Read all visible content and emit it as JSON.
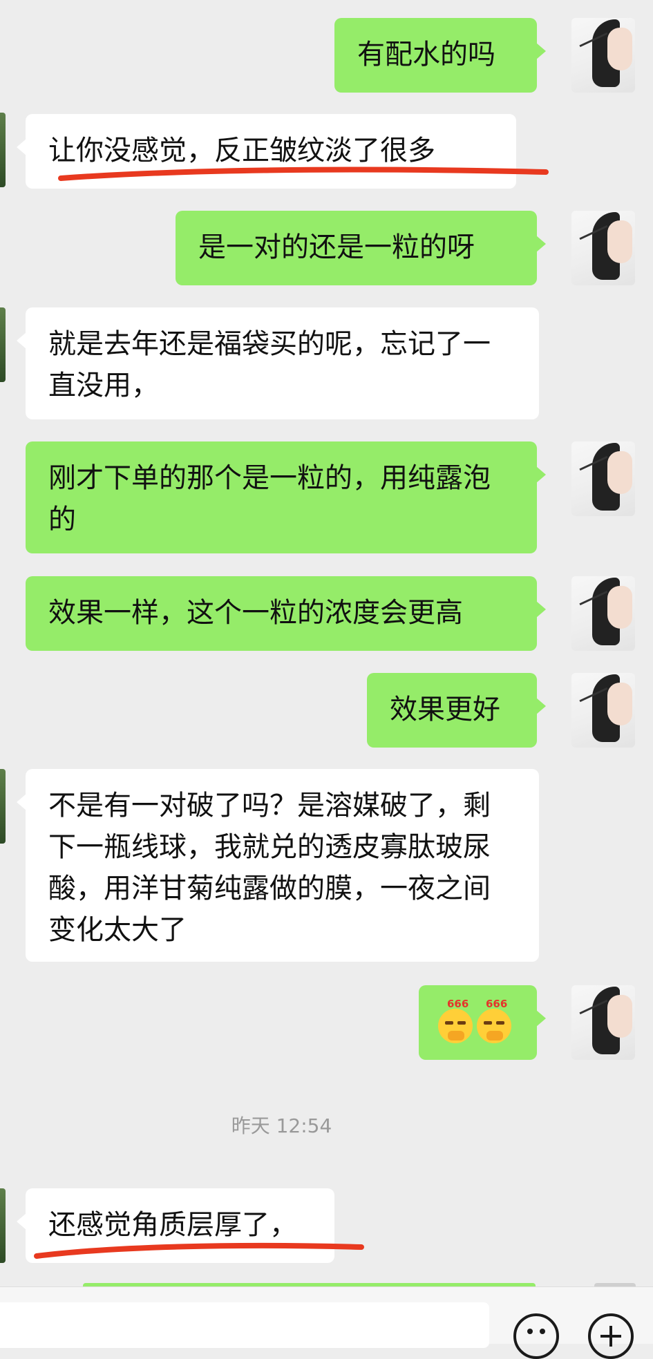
{
  "chat": {
    "messages": [
      {
        "sender": "me",
        "text": "有配水的吗"
      },
      {
        "sender": "them",
        "text": "让你没感觉，反正皱纹淡了很多"
      },
      {
        "sender": "me",
        "text": "是一对的还是一粒的呀"
      },
      {
        "sender": "them",
        "text": "就是去年还是福袋买的呢，忘记了一直没用，"
      },
      {
        "sender": "me",
        "text": "刚才下单的那个是一粒的，用纯露泡的"
      },
      {
        "sender": "me",
        "text": "效果一样，这个一粒的浓度会更高"
      },
      {
        "sender": "me",
        "text": "效果更好"
      },
      {
        "sender": "them",
        "text": "不是有一对破了吗？是溶媒破了，剩下一瓶线球，我就兑的透皮寡肽玻尿酸，用洋甘菊纯露做的膜，一夜之间变化太大了"
      },
      {
        "sender": "me",
        "type": "emoji",
        "emojis": [
          {
            "name": "666-emoji",
            "label": "666"
          },
          {
            "name": "666-emoji",
            "label": "666"
          }
        ]
      },
      {
        "sender": "them",
        "text": "还感觉角质层厚了，"
      }
    ],
    "timestamp": "昨天 12:54"
  },
  "annotations": {
    "underline_color": "#e8391f"
  },
  "colors": {
    "background": "#ededed",
    "my_bubble": "#95ec69",
    "their_bubble": "#ffffff",
    "timestamp_text": "#999999"
  },
  "input_bar": {
    "emoji_icon": "emoji-smiley-icon",
    "plus_icon": "plus-icon"
  }
}
